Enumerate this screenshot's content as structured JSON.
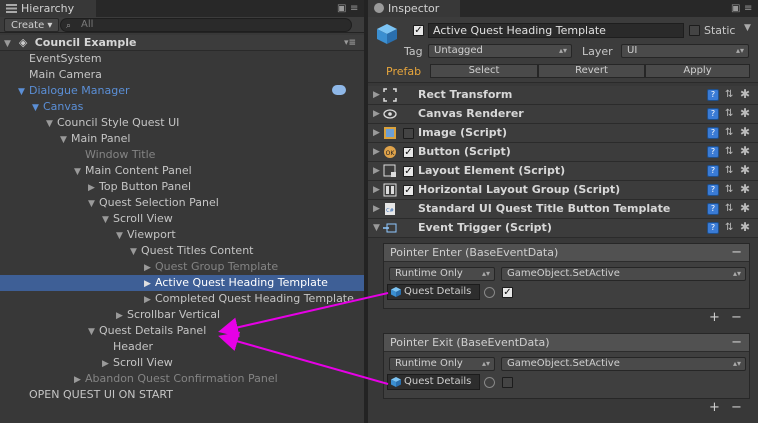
{
  "hierarchy": {
    "tab_label": "Hierarchy",
    "create_label": "Create",
    "search_placeholder": "All",
    "root_label": "Council Example",
    "rows": [
      {
        "label": "EventSystem"
      },
      {
        "label": "Main Camera"
      },
      {
        "label": "Dialogue Manager"
      },
      {
        "label": "Canvas"
      },
      {
        "label": "Council Style Quest UI"
      },
      {
        "label": "Main Panel"
      },
      {
        "label": "Window Title"
      },
      {
        "label": "Main Content Panel"
      },
      {
        "label": "Top Button Panel"
      },
      {
        "label": "Quest Selection Panel"
      },
      {
        "label": "Scroll View"
      },
      {
        "label": "Viewport"
      },
      {
        "label": "Quest Titles Content"
      },
      {
        "label": "Quest Group Template"
      },
      {
        "label": "Active Quest Heading Template"
      },
      {
        "label": "Completed Quest Heading Template"
      },
      {
        "label": "Scrollbar Vertical"
      },
      {
        "label": "Quest Details Panel"
      },
      {
        "label": "Header"
      },
      {
        "label": "Scroll View"
      },
      {
        "label": "Abandon Quest Confirmation Panel"
      },
      {
        "label": "OPEN QUEST UI ON START"
      }
    ]
  },
  "inspector": {
    "tab_label": "Inspector",
    "object_name": "Active Quest Heading Template",
    "static_label": "Static",
    "tag_label": "Tag",
    "tag_value": "Untagged",
    "layer_label": "Layer",
    "layer_value": "UI",
    "prefab_label": "Prefab",
    "select_label": "Select",
    "revert_label": "Revert",
    "apply_label": "Apply",
    "components": [
      {
        "name": "Rect Transform",
        "icon": "rect-transform-icon"
      },
      {
        "name": "Canvas Renderer",
        "icon": "eye-icon"
      },
      {
        "name": "Image (Script)",
        "icon": "image-icon"
      },
      {
        "name": "Button (Script)",
        "icon": "button-icon"
      },
      {
        "name": "Layout Element (Script)",
        "icon": "layout-element-icon"
      },
      {
        "name": "Horizontal Layout Group (Script)",
        "icon": "horizontal-layout-icon"
      },
      {
        "name": "Standard UI Quest Title Button Template",
        "icon": "script-icon"
      },
      {
        "name": "Event Trigger (Script)",
        "icon": "event-trigger-icon"
      }
    ],
    "events": [
      {
        "title": "Pointer Enter (BaseEventData)",
        "runtime": "Runtime Only",
        "function": "GameObject.SetActive",
        "object": "Quest Details",
        "checked": true
      },
      {
        "title": "Pointer Exit (BaseEventData)",
        "runtime": "Runtime Only",
        "function": "GameObject.SetActive",
        "object": "Quest Details",
        "checked": false
      }
    ]
  },
  "colors": {
    "selection": "#3e5f96",
    "prefab_blue": "#5b8fd6",
    "annotation_arrow": "#e600e6",
    "prefab_label": "#e6a53c"
  }
}
